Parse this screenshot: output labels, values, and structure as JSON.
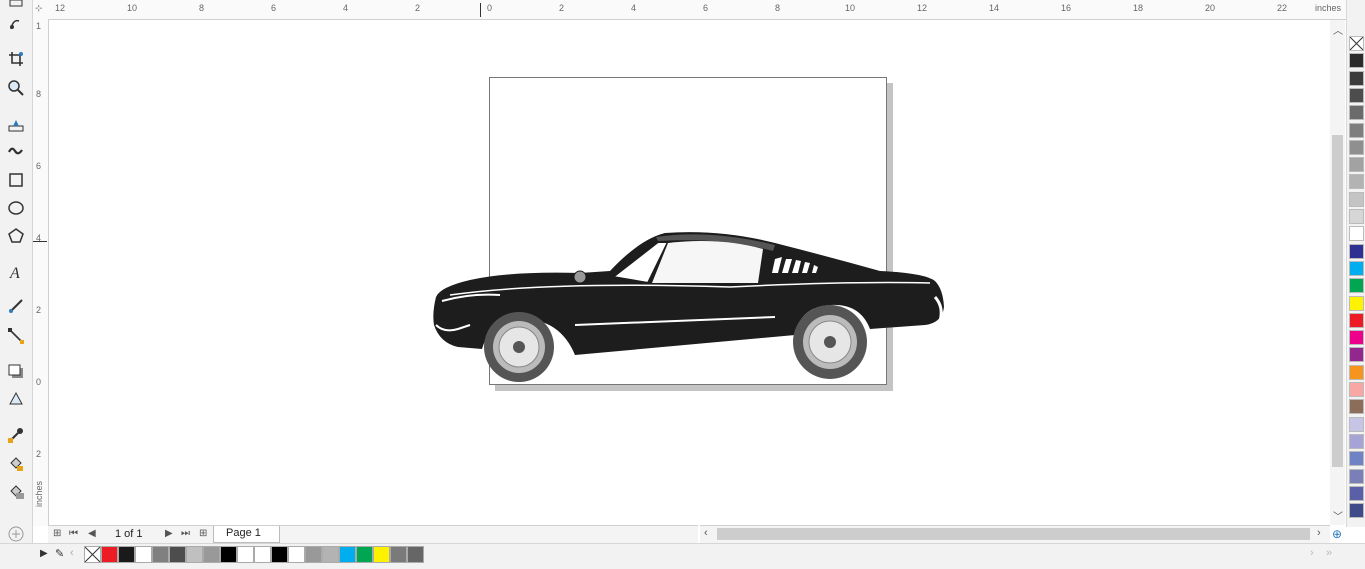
{
  "ruler": {
    "unit": "inches",
    "top_labels": [
      "12",
      "10",
      "8",
      "6",
      "4",
      "2",
      "0",
      "2",
      "4",
      "6",
      "8",
      "10",
      "12",
      "14",
      "16",
      "18",
      "20",
      "22"
    ],
    "left_labels": [
      "1",
      "8",
      "6",
      "4",
      "2",
      "0",
      "2"
    ]
  },
  "toolbox": {
    "tools": [
      "pick-tool",
      "freehand-pick-tool",
      "crop-tool",
      "zoom-tool",
      "pen-tool",
      "artistic-media-tool",
      "rectangle-tool",
      "ellipse-tool",
      "polygon-tool",
      "text-tool",
      "dimension-tool",
      "connector-tool",
      "drop-shadow-tool",
      "transparency-tool",
      "color-eyedropper-tool",
      "interactive-fill-tool",
      "smart-fill-tool",
      "add-tool"
    ]
  },
  "page_nav": {
    "count": "1 of 1",
    "tab": "Page 1"
  },
  "palette_right": {
    "colors": [
      "none",
      "#2b2b2b",
      "#3c3c3c",
      "#4d4d4d",
      "#6b6b6b",
      "#7e7e7e",
      "#8f8f8f",
      "#a2a2a2",
      "#b3b3b3",
      "#c4c4c4",
      "#d6d6d6",
      "#ffffff",
      "#2e3192",
      "#00aeef",
      "#00a651",
      "#fff200",
      "#ed1c24",
      "#ec008c",
      "#92278f",
      "#f7941d",
      "#f9a7a5",
      "#8c6d5a",
      "#c7c5e6",
      "#a6a4d6",
      "#6f83c4",
      "#7b7fb8",
      "#5960a8",
      "#3f4a8a"
    ]
  },
  "palette_bottom": {
    "colors": [
      "none",
      "#ed1c24",
      "#1a1a1a",
      "#ffffff",
      "#808080",
      "#4d4d4d",
      "#c0c0c0",
      "#999999",
      "#000000",
      "#ffffff",
      "#ffffff",
      "#000000",
      "#ffffff",
      "#999999",
      "#b3b3b3",
      "#00aeef",
      "#00a651",
      "#fff200",
      "#7a7a7a",
      "#666666"
    ]
  }
}
